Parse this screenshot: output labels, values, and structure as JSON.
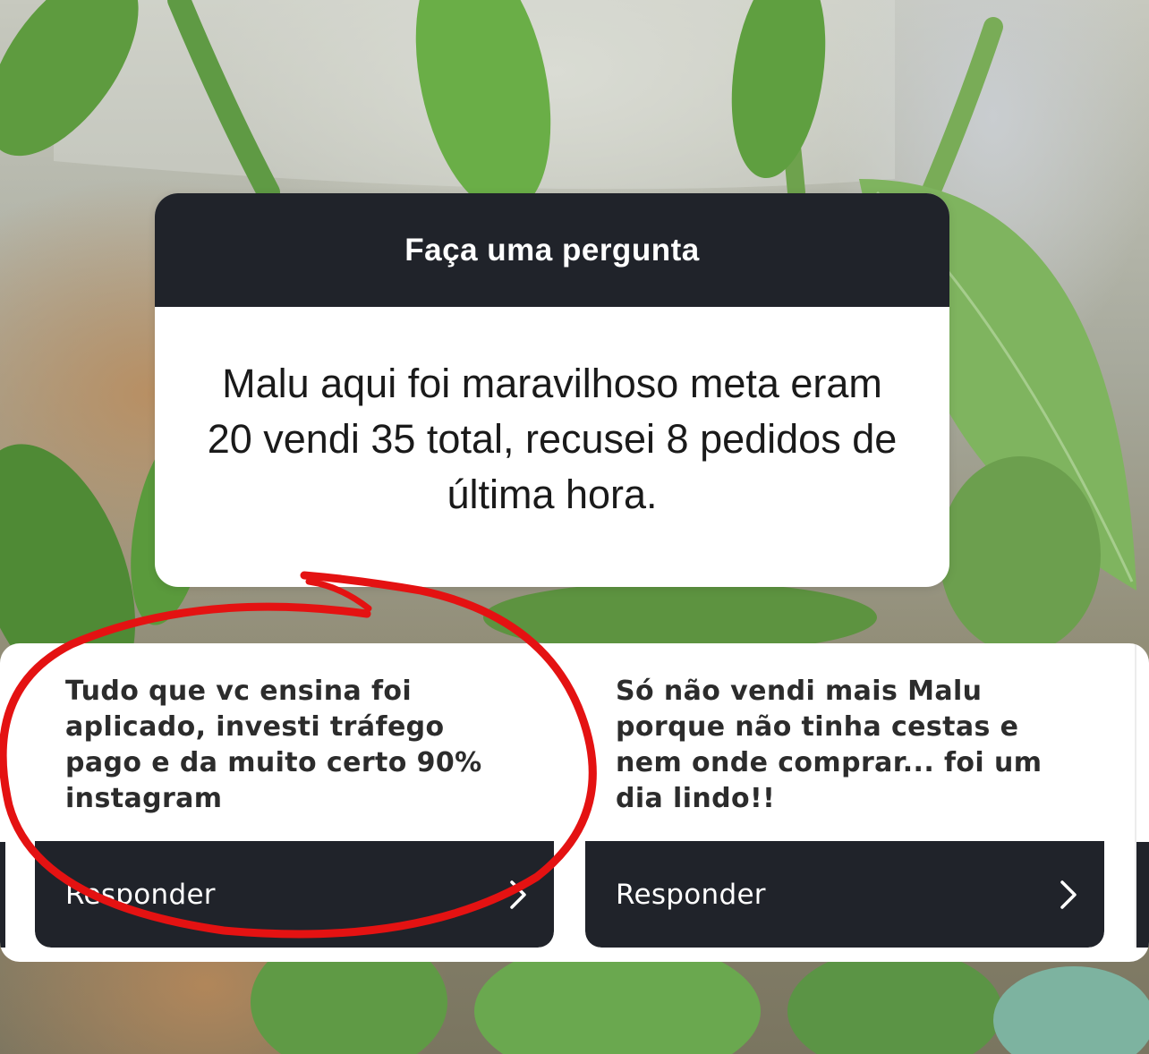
{
  "question_box": {
    "header": "Faça uma pergunta",
    "text": "Malu aqui foi maravilhoso meta eram 20 vendi 35 total, recusei 8 pedidos de última hora."
  },
  "responses": [
    {
      "text": "Tudo que vc ensina foi aplicado, investi tráfego pago e da muito certo 90% instagram",
      "button_label": "Responder",
      "icon": "chevron-right-icon"
    },
    {
      "text": "Só não vendi mais Malu porque não tinha cestas e nem onde comprar... foi um dia lindo!!",
      "button_label": "Responder",
      "icon": "chevron-right-icon"
    }
  ],
  "colors": {
    "header_bg": "#20232a",
    "card_bg": "#ffffff",
    "annotation": "#e41212",
    "leaf": "#6aa84f"
  }
}
